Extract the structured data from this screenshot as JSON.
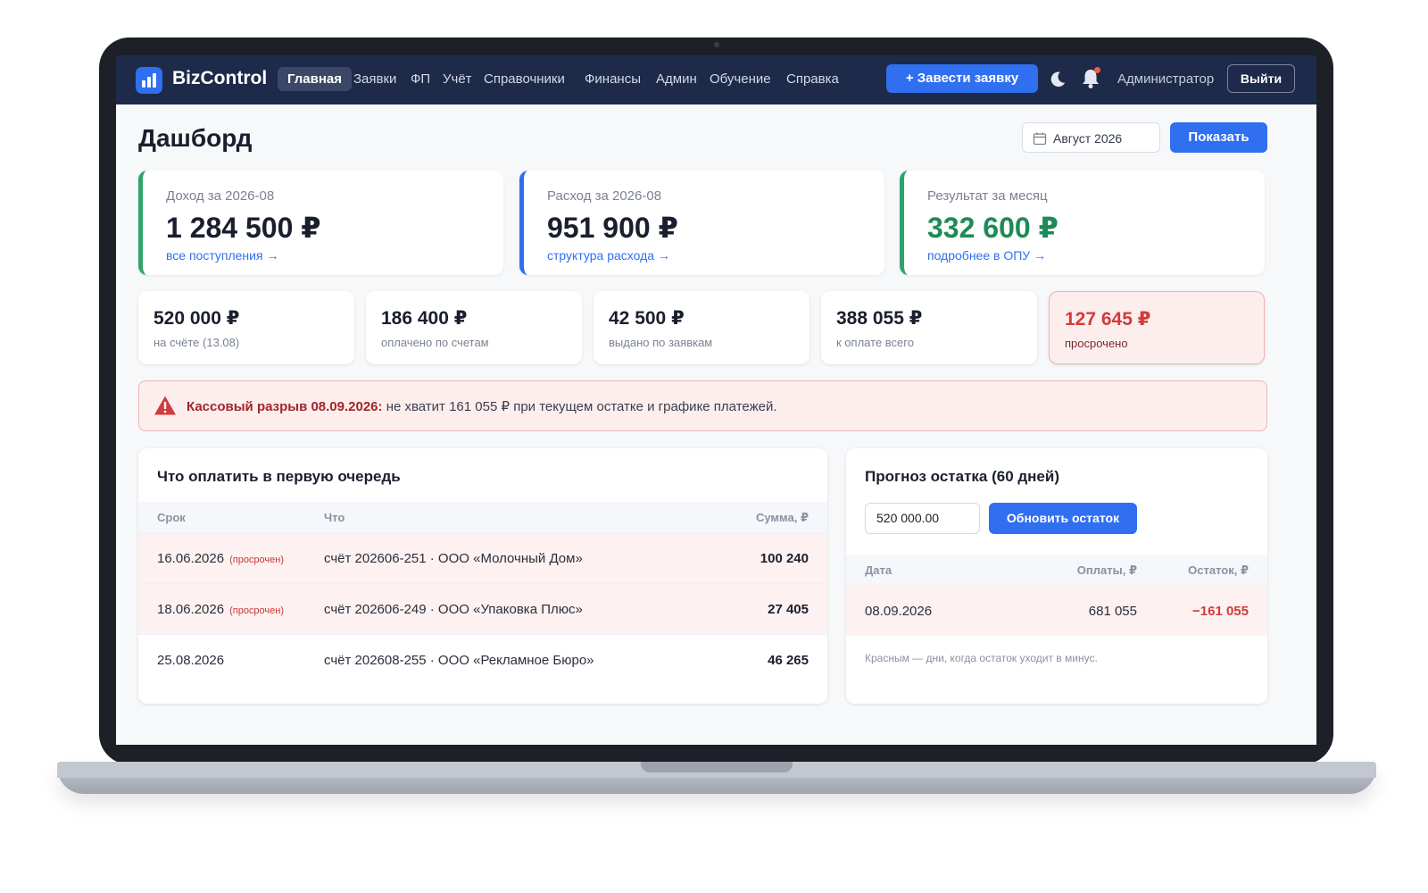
{
  "nav": {
    "brand": "BizControl",
    "items": [
      "Главная",
      "Заявки",
      "ФП",
      "Учёт",
      "Справочники",
      "Финансы",
      "Админ",
      "Обучение",
      "Справка"
    ],
    "cta_label": "+ Завести заявку",
    "user": "Администратор",
    "logout_label": "Выйти"
  },
  "header": {
    "title": "Дашборд",
    "month_value": "Август 2026",
    "show_label": "Показать"
  },
  "kpis": [
    {
      "label": "Доход за 2026-08",
      "value": "1 284 500 ₽",
      "link": "все поступления →",
      "accent": "#2fa36b",
      "value_color": "#1a1f2e"
    },
    {
      "label": "Расход за 2026-08",
      "value": "951 900 ₽",
      "link": "структура расхода →",
      "accent": "#2f6ff0",
      "value_color": "#1a1f2e"
    },
    {
      "label": "Результат за месяц",
      "value": "332 600 ₽",
      "link": "подробнее в ОПУ →",
      "accent": "#2fa36b",
      "value_color": "#1f8a55"
    }
  ],
  "stats": [
    {
      "value": "520 000 ₽",
      "label": "на счёте (13.08)"
    },
    {
      "value": "186 400 ₽",
      "label": "оплачено по счетам"
    },
    {
      "value": "42 500 ₽",
      "label": "выдано по заявкам"
    },
    {
      "value": "388 055 ₽",
      "label": "к оплате всего"
    },
    {
      "value": "127 645 ₽",
      "label": "просрочено"
    }
  ],
  "alert": {
    "title": "Кассовый разрыв 08.09.2026:",
    "text": " не хватит 161 055 ₽ при текущем остатке и графике платежей."
  },
  "pay_first": {
    "title": "Что оплатить в первую очередь",
    "headers": {
      "date": "Срок",
      "what": "Что",
      "amount": "Сумма, ₽"
    },
    "rows": [
      {
        "date": "16.06.2026",
        "tag": "(просрочен)",
        "what": "счёт 202606-251 · ООО «Молочный Дом»",
        "amount": "100 240"
      },
      {
        "date": "18.06.2026",
        "tag": "(просрочен)",
        "what": "счёт 202606-249 · ООО «Упаковка Плюс»",
        "amount": "27 405"
      },
      {
        "date": "25.08.2026",
        "tag": "",
        "what": "счёт 202608-255 · ООО «Рекламное Бюро»",
        "amount": "46 265"
      }
    ]
  },
  "forecast": {
    "title": "Прогноз остатка (60 дней)",
    "balance_value": "520 000.00",
    "update_label": "Обновить остаток",
    "headers": {
      "date": "Дата",
      "payments": "Оплаты, ₽",
      "balance": "Остаток, ₽"
    },
    "rows": [
      {
        "date": "08.09.2026",
        "payments": "681 055",
        "balance": "−161 055"
      }
    ],
    "note": "Красным — дни, когда остаток уходит в минус."
  },
  "colors": {
    "nav_bg": "#1e2a4a",
    "primary": "#2f6ff0",
    "danger": "#d13b3b",
    "success": "#2fa36b"
  }
}
